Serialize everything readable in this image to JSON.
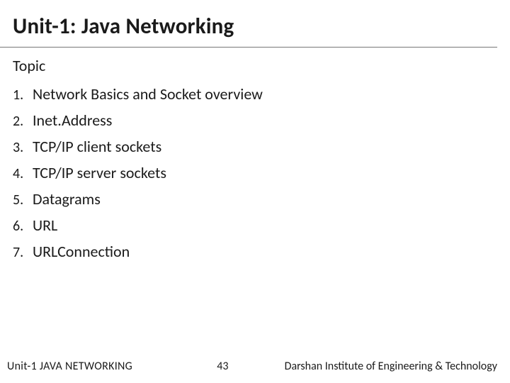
{
  "title": "Unit-1: Java Networking",
  "topic_label": "Topic",
  "items": [
    {
      "n": "1.",
      "t": "Network Basics and Socket overview"
    },
    {
      "n": "2.",
      "t": "Inet.Address"
    },
    {
      "n": "3.",
      "t": "TCP/IP client sockets"
    },
    {
      "n": "4.",
      "t": "TCP/IP server sockets"
    },
    {
      "n": "5.",
      "t": "Datagrams"
    },
    {
      "n": "6.",
      "t": "URL"
    },
    {
      "n": "7.",
      "t": "URLConnection"
    }
  ],
  "footer": {
    "left": "Unit-1 JAVA NETWORKING",
    "page": "43",
    "right": "Darshan Institute of Engineering & Technology"
  }
}
